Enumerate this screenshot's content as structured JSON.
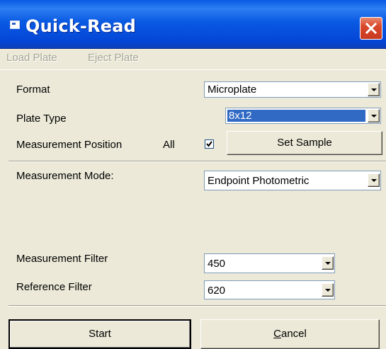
{
  "window": {
    "title": "Quick-Read"
  },
  "menu": {
    "items": [
      "Load Plate",
      "Eject Plate"
    ]
  },
  "form": {
    "format": {
      "label": "Format",
      "value": "Microplate"
    },
    "plate_type": {
      "label": "Plate Type",
      "value": "8x12"
    },
    "measurement_position": {
      "label": "Measurement Position",
      "all_label": "All",
      "checked": true,
      "set_sample_label": "Set Sample"
    },
    "measurement_mode": {
      "label": "Measurement Mode:",
      "value": "Endpoint Photometric"
    },
    "measurement_filter": {
      "label": "Measurement Filter",
      "value": "450"
    },
    "reference_filter": {
      "label": "Reference Filter",
      "value": "620"
    }
  },
  "buttons": {
    "start_label": "Start",
    "cancel_label": "Cancel"
  },
  "icons": {
    "app": "window-icon",
    "close": "close-icon",
    "dropdown": "chevron-down-icon",
    "check": "checkmark-icon"
  },
  "colors": {
    "titlebar": "#0a5ae3",
    "close_button": "#d9482c",
    "selection": "#316ac5",
    "dialog_bg": "#ece9d8"
  }
}
